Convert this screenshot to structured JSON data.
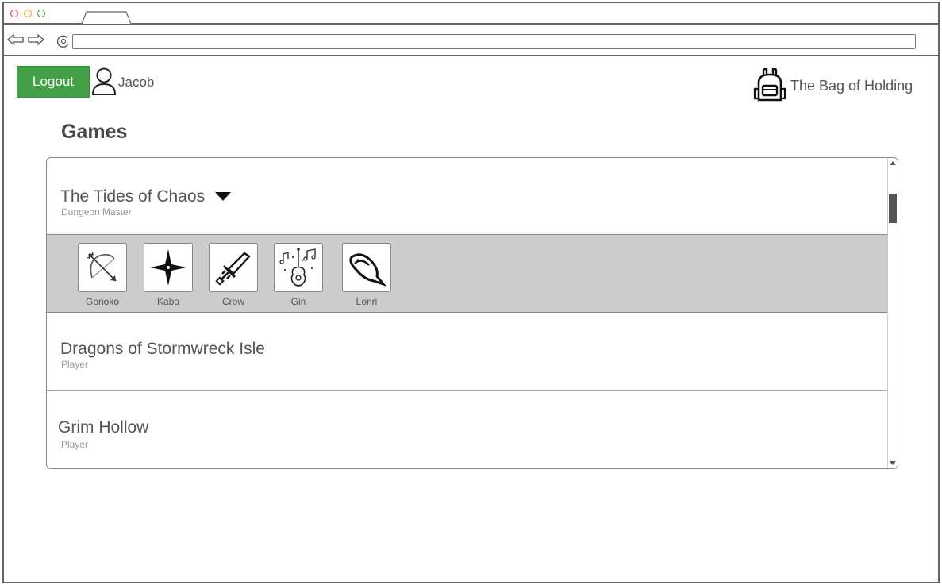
{
  "header": {
    "logout_label": "Logout",
    "username": "Jacob",
    "brand": "The Bag of Holding"
  },
  "page": {
    "title": "Games"
  },
  "games": [
    {
      "title": "The Tides of Chaos",
      "role": "Dungeon Master",
      "expanded": true,
      "characters": [
        {
          "name": "Gonoko",
          "icon": "bow-arrow-icon"
        },
        {
          "name": "Kaba",
          "icon": "shuriken-icon"
        },
        {
          "name": "Crow",
          "icon": "sword-icon"
        },
        {
          "name": "Gin",
          "icon": "guitar-music-icon"
        },
        {
          "name": "Lonri",
          "icon": "fish-icon"
        }
      ]
    },
    {
      "title": "Dragons of Stormwreck Isle",
      "role": "Player"
    },
    {
      "title": "Grim Hollow",
      "role": "Player"
    }
  ],
  "colors": {
    "logout_bg": "#43a047",
    "expanded_bg": "#cccccc"
  }
}
